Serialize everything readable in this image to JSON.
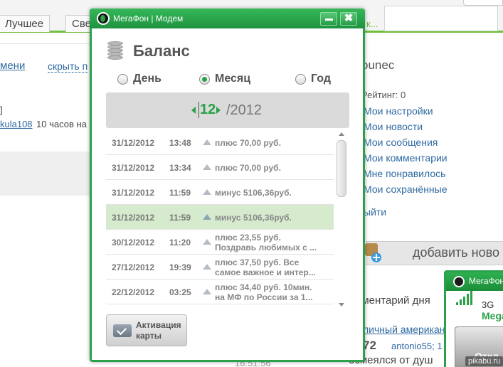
{
  "background": {
    "tabs": [
      "Лучшее",
      "Све"
    ],
    "links": {
      "meni": "мени",
      "hide": "скрыть п",
      "user": "kula108",
      "posted": "10 часов на",
      "bracket": "]"
    },
    "right_panel": {
      "username": "ounec",
      "rating": "Рейтинг: 0",
      "menu": [
        "Мои настройки",
        "Мои новости",
        "Мои сообщения",
        "Мои комментарии",
        "Мне понравилось",
        "Мои сохранённые"
      ],
      "logout": "ыйти",
      "add_news": "добавить ново",
      "comment_day": "мментарий дня",
      "comment_link": "личный американ",
      "comment_num": "72",
      "comment_user": "antonio55; 1",
      "comment_text": "осмеялся от душ",
      "time_bottom": "16:51:56"
    },
    "mini_widget": {
      "title": "МегаФон | М",
      "network": "3G",
      "operator": "Mega",
      "button": "Откл"
    },
    "watermark": "pikabu.ru"
  },
  "widget": {
    "title": "МегаФон | Модем",
    "minimize_icon": "minimize-icon",
    "close_icon": "close-icon",
    "section_title": "Баланс",
    "periods": [
      {
        "label": "День",
        "checked": false
      },
      {
        "label": "Месяц",
        "checked": true
      },
      {
        "label": "Год",
        "checked": false
      }
    ],
    "date": {
      "month": "12",
      "year": "/2012"
    },
    "transactions": [
      {
        "date": "31/12/2012",
        "time": "13:48",
        "desc1": "плюс 70,00 руб.",
        "desc2": "",
        "selected": false
      },
      {
        "date": "31/12/2012",
        "time": "13:34",
        "desc1": "плюс 70,00 руб.",
        "desc2": "",
        "selected": false
      },
      {
        "date": "31/12/2012",
        "time": "11:59",
        "desc1": "минус 5106,36руб.",
        "desc2": "",
        "selected": false
      },
      {
        "date": "31/12/2012",
        "time": "11:59",
        "desc1": "минус 5106,36руб.",
        "desc2": "",
        "selected": true
      },
      {
        "date": "30/12/2012",
        "time": "11:20",
        "desc1": "плюс 23,55 руб.",
        "desc2": "Поздравь любимых с ...",
        "selected": false
      },
      {
        "date": "27/12/2012",
        "time": "19:39",
        "desc1": "плюс 37,50 руб. Все",
        "desc2": "самое важное и интер...",
        "selected": false
      },
      {
        "date": "22/12/2012",
        "time": "03:25",
        "desc1": "плюс 34,40 руб. 10мин.",
        "desc2": "на МФ по России за 1...",
        "selected": false
      }
    ],
    "activate_button": {
      "line1": "Активация",
      "line2": "карты"
    },
    "colors": {
      "accent": "#2aa14a",
      "selected_row": "#d6eacd"
    }
  }
}
